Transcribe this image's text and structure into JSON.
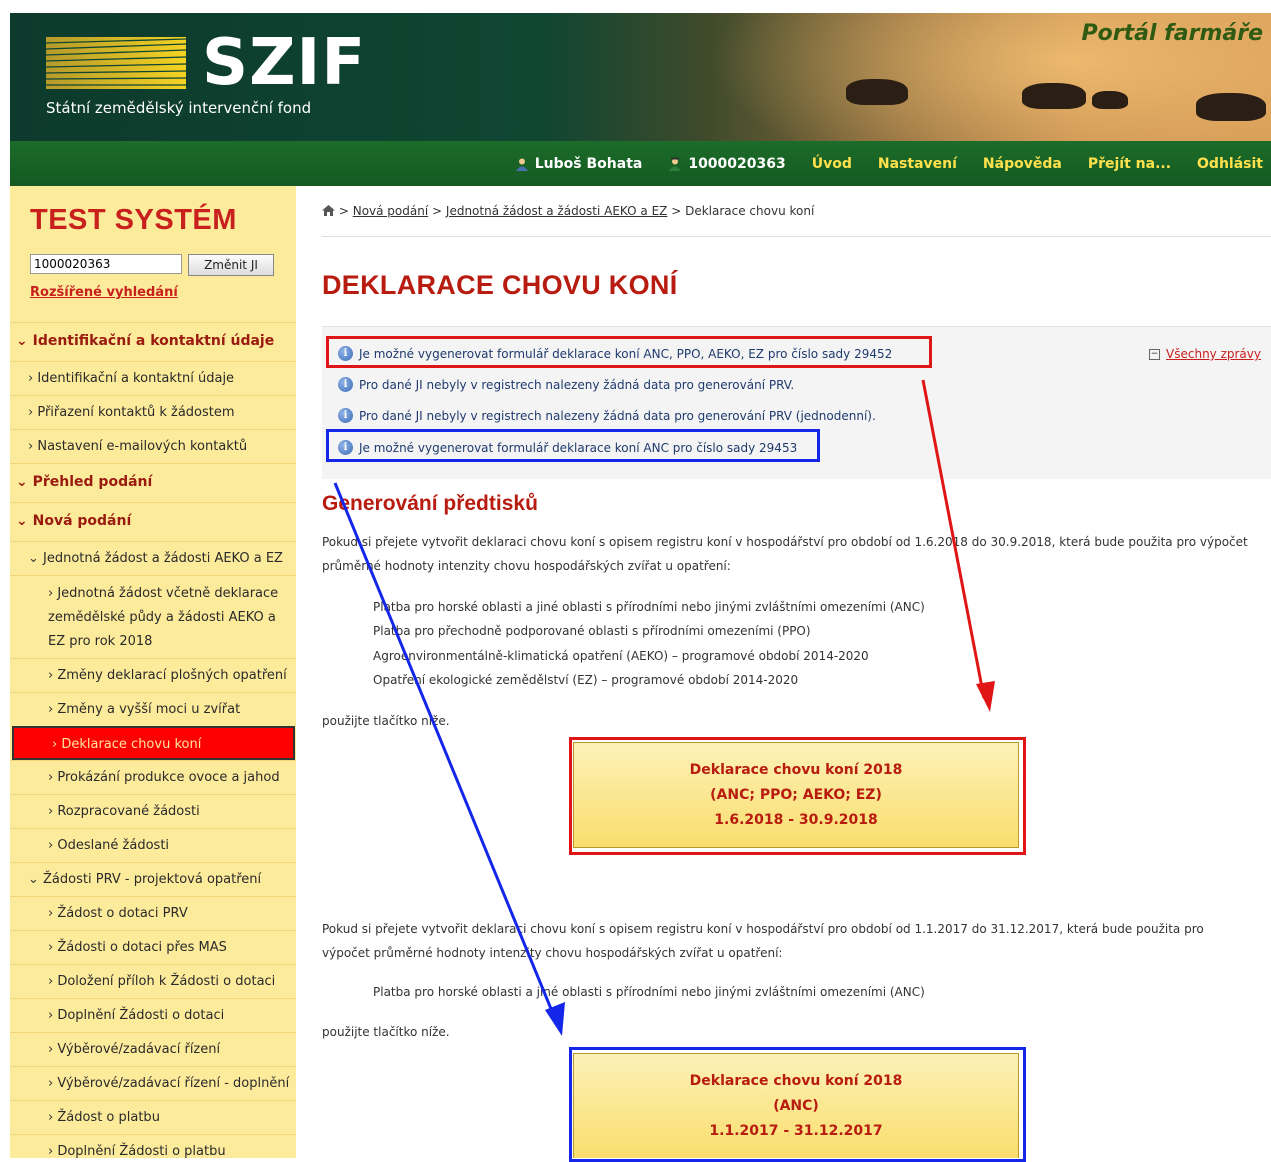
{
  "header": {
    "logo_text": "SZIF",
    "logo_subtitle": "Státní zemědělský intervenční fond",
    "portal_name": "Portál farmáře",
    "brand_color": "#145a21"
  },
  "navbar": {
    "user_name": "Luboš Bohata",
    "ji_number": "1000020363",
    "links": [
      "Úvod",
      "Nastavení",
      "Nápověda",
      "Přejít na...",
      "Odhlásit"
    ]
  },
  "sidebar": {
    "test_label": "TEST SYSTÉM",
    "ji_input_value": "1000020363",
    "change_button": "Změnit JI",
    "advanced_search": "Rozšířené vyhledání",
    "menu": [
      {
        "label": "Identifikační a kontaktní údaje",
        "kind": "header"
      },
      {
        "label": "Identifikační a kontaktní údaje",
        "kind": "l1"
      },
      {
        "label": "Přiřazení kontaktů k žádostem",
        "kind": "l1"
      },
      {
        "label": "Nastavení e-mailových kontaktů",
        "kind": "l1"
      },
      {
        "label": "Přehled podání",
        "kind": "header"
      },
      {
        "label": "Nová podání",
        "kind": "header"
      },
      {
        "label": "Jednotná žádost a žádosti AEKO a EZ",
        "kind": "sub"
      },
      {
        "label": "Jednotná žádost včetně deklarace zemědělské půdy a žádosti AEKO a EZ pro rok 2018",
        "kind": "l2tall"
      },
      {
        "label": "Změny deklarací plošných opatření",
        "kind": "l2"
      },
      {
        "label": "Změny a vyšší moci u zvířat",
        "kind": "l2"
      },
      {
        "label": "Deklarace chovu koní",
        "kind": "active"
      },
      {
        "label": "Prokázání produkce ovoce a jahod",
        "kind": "l2"
      },
      {
        "label": "Rozpracované žádosti",
        "kind": "l2"
      },
      {
        "label": "Odeslané žádosti",
        "kind": "l2"
      },
      {
        "label": "Žádosti PRV - projektová opatření",
        "kind": "sub"
      },
      {
        "label": "Žádost o dotaci PRV",
        "kind": "l2"
      },
      {
        "label": "Žádosti o dotaci přes MAS",
        "kind": "l2"
      },
      {
        "label": "Doložení příloh k Žádosti o dotaci",
        "kind": "l2"
      },
      {
        "label": "Doplnění Žádosti o dotaci",
        "kind": "l2"
      },
      {
        "label": "Výběrové/zadávací řízení",
        "kind": "l2"
      },
      {
        "label": "Výběrové/zadávací řízení - doplnění",
        "kind": "l2"
      },
      {
        "label": "Žádost o platbu",
        "kind": "l2"
      },
      {
        "label": "Doplnění Žádosti o platbu",
        "kind": "l2"
      }
    ]
  },
  "breadcrumb": {
    "sep": ">",
    "item1": "Nová podání",
    "item2": "Jednotná žádost a žádosti AEKO a EZ",
    "current": "Deklarace chovu koní"
  },
  "page": {
    "title": "DEKLARACE CHOVU KONÍ",
    "messages": [
      "Je možné vygenerovat formulář deklarace koní ANC, PPO, AEKO, EZ pro číslo sady 29452",
      "Pro dané JI nebyly v registrech nalezeny žádná data pro generování PRV.",
      "Pro dané JI nebyly v registrech nalezeny žádná data pro generování PRV (jednodenní).",
      "Je možné vygenerovat formulář deklarace koní ANC pro číslo sady 29453"
    ],
    "all_messages": "Všechny zprávy",
    "section_title": "Generování předtisků",
    "para1": "Pokud si přejete vytvořit deklaraci chovu koní s opisem registru koní v hospodářství pro období od 1.6.2018 do 30.9.2018, která bude použita pro výpočet průměrné hodnoty intenzity chovu hospodářských zvířat u opatření:",
    "list1": [
      "Platba pro horské oblasti a jiné oblasti s přírodními nebo jinými zvláštními omezeními (ANC)",
      "Platba pro přechodně podporované oblasti s přírodními omezeními (PPO)",
      "Agroenvironmentálně-klimatická opatření (AEKO) – programové období 2014-2020",
      "Opatření ekologické zemědělství (EZ) – programové období 2014-2020"
    ],
    "use_button": "použijte tlačítko níže.",
    "button1": {
      "line1": "Deklarace chovu koní 2018",
      "line2": "(ANC; PPO; AEKO; EZ)",
      "line3": "1.6.2018 - 30.9.2018"
    },
    "para2": "Pokud si přejete vytvořit deklaraci chovu koní s opisem registru koní v hospodářství pro období od 1.1.2017 do 31.12.2017, která bude použita pro výpočet průměrné hodnoty intenzity chovu hospodářských zvířat u opatření:",
    "list2": [
      "Platba pro horské oblasti a jiné oblasti s přírodními nebo jinými zvláštními omezeními (ANC)"
    ],
    "button2": {
      "line1": "Deklarace chovu koní 2018",
      "line2": "(ANC)",
      "line3": "1.1.2017 - 31.12.2017"
    }
  },
  "annotation_colors": {
    "red": "#e01515",
    "blue": "#1427e8"
  }
}
